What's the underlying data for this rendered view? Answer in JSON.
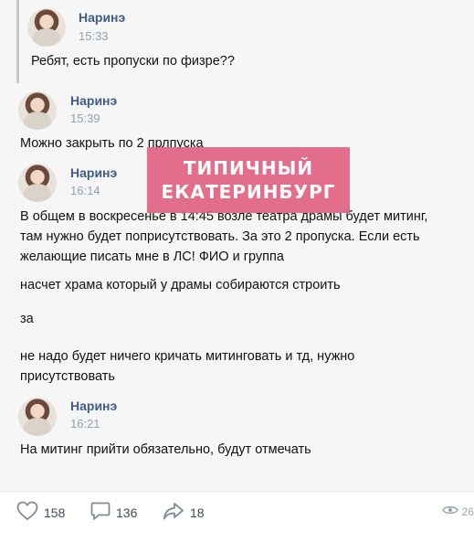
{
  "messages": [
    {
      "author": "Наринэ",
      "time": "15:33",
      "text": "Ребят, есть пропуски по физре??"
    },
    {
      "author": "Наринэ",
      "time": "15:39",
      "text": "Можно закрыть по 2 прлпуска"
    },
    {
      "author": "Наринэ",
      "time": "16:14",
      "paragraphs": [
        "В общем в воскресенье в 14:45 возле театра драмы будет митинг,\nтам нужно будет поприсутствовать. За это 2 пропуска. Если есть\nжелающие писать мне в ЛС! ФИО и группа",
        "насчет храма который у драмы собираются строить",
        "за",
        "не надо будет ничего кричать митинговать и тд, нужно\nприсутствовать"
      ]
    },
    {
      "author": "Наринэ",
      "time": "16:21",
      "text": "На митинг прийти обязательно, будут отмечать"
    }
  ],
  "watermark": {
    "line1": "ТИПИЧНЫЙ",
    "line2": "ЕКАТЕРИНБУРГ"
  },
  "footer": {
    "likes": "158",
    "comments": "136",
    "shares": "18",
    "views": "26"
  },
  "colors": {
    "name": "#3f5c87",
    "time": "#93a0ad",
    "watermark_bg": "#e06080"
  }
}
